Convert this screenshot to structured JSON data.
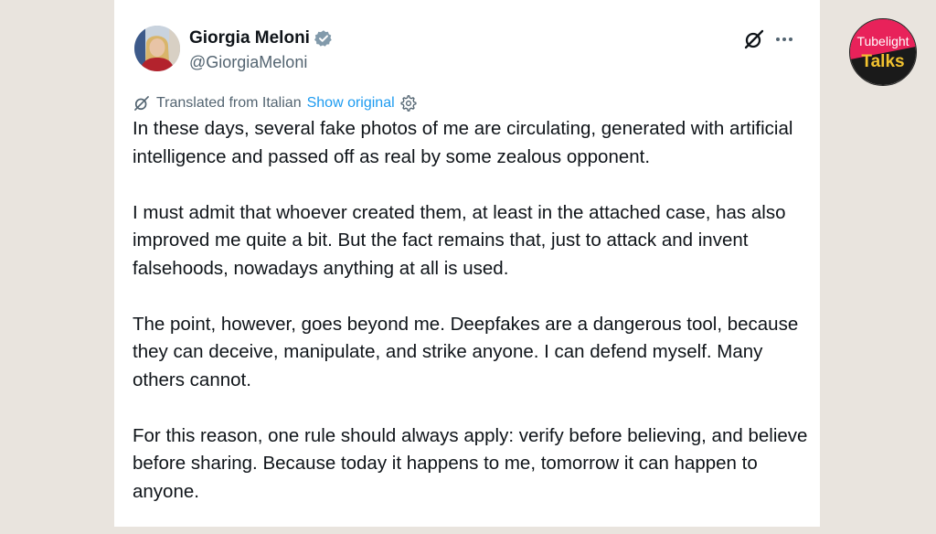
{
  "author": {
    "display_name": "Giorgia Meloni",
    "handle": "@GiorgiaMeloni"
  },
  "translation": {
    "label": "Translated from Italian",
    "show_original": "Show original"
  },
  "tweet": {
    "paragraphs": [
      "In these days, several fake photos of me are circulating, generated with artificial intelligence and passed off as real by some zealous opponent.",
      "I must admit that whoever created them, at least in the attached case, has also improved me quite a bit. But the fact remains that, just to attack and invent falsehoods, nowadays anything at all is used.",
      "The point, however, goes beyond me. Deepfakes are a dangerous tool, because they can deceive, manipulate, and strike anyone. I can defend myself. Many others cannot.",
      "For this reason, one rule should always apply: verify before believing, and believe before sharing. Because today it happens to me, tomorrow it can happen to anyone."
    ]
  },
  "watermark": {
    "line1": "Tubelight",
    "line2": "Talks"
  },
  "colors": {
    "accent": "#1d9bf0",
    "text": "#0f1419",
    "muted": "#536471",
    "background": "#e9e4de",
    "logo_pink": "#e8225a"
  },
  "icons": {
    "verified": "verified-badge-icon",
    "grok": "grok-icon",
    "more": "more-options-icon",
    "translate": "translate-icon",
    "settings": "settings-gear-icon"
  }
}
